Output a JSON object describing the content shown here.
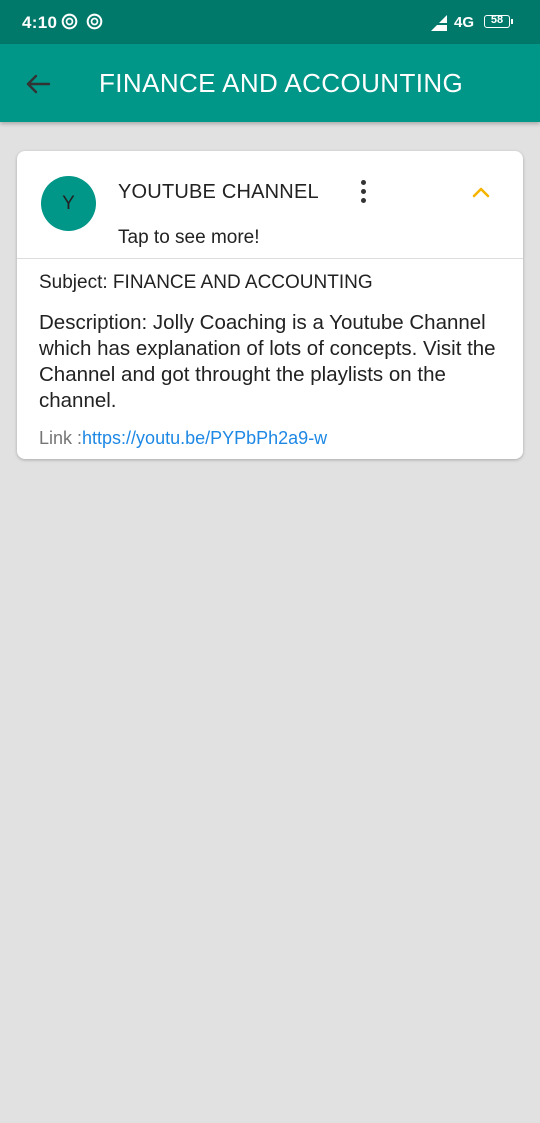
{
  "status_bar": {
    "time": "4:10",
    "network": "4G",
    "battery": "58"
  },
  "app_bar": {
    "title": "FINANCE AND ACCOUNTING"
  },
  "card": {
    "avatar_letter": "Y",
    "title": "YOUTUBE CHANNEL",
    "subtitle": "Tap to see more!",
    "subject": "Subject: FINANCE AND ACCOUNTING",
    "description": "Description: Jolly Coaching is a Youtube Channel which has explanation of lots of concepts. Visit the Channel and got throught the playlists on the channel.",
    "link_label": "Link :",
    "link_url": "https://youtu.be/PYPbPh2a9-w"
  },
  "colors": {
    "status_bar": "#00796b",
    "app_bar": "#009688",
    "avatar": "#009688",
    "expand_chevron": "#f5b400",
    "link": "#1e88e5",
    "background": "#e1e1e1"
  },
  "icons": {
    "status_left": [
      "sync-icon",
      "sync-icon"
    ],
    "status_right": [
      "signal-icon",
      "battery-icon"
    ],
    "app_bar": "arrow-back-icon",
    "card_menu": "more-vert-icon",
    "card_expand": "chevron-up-icon"
  }
}
